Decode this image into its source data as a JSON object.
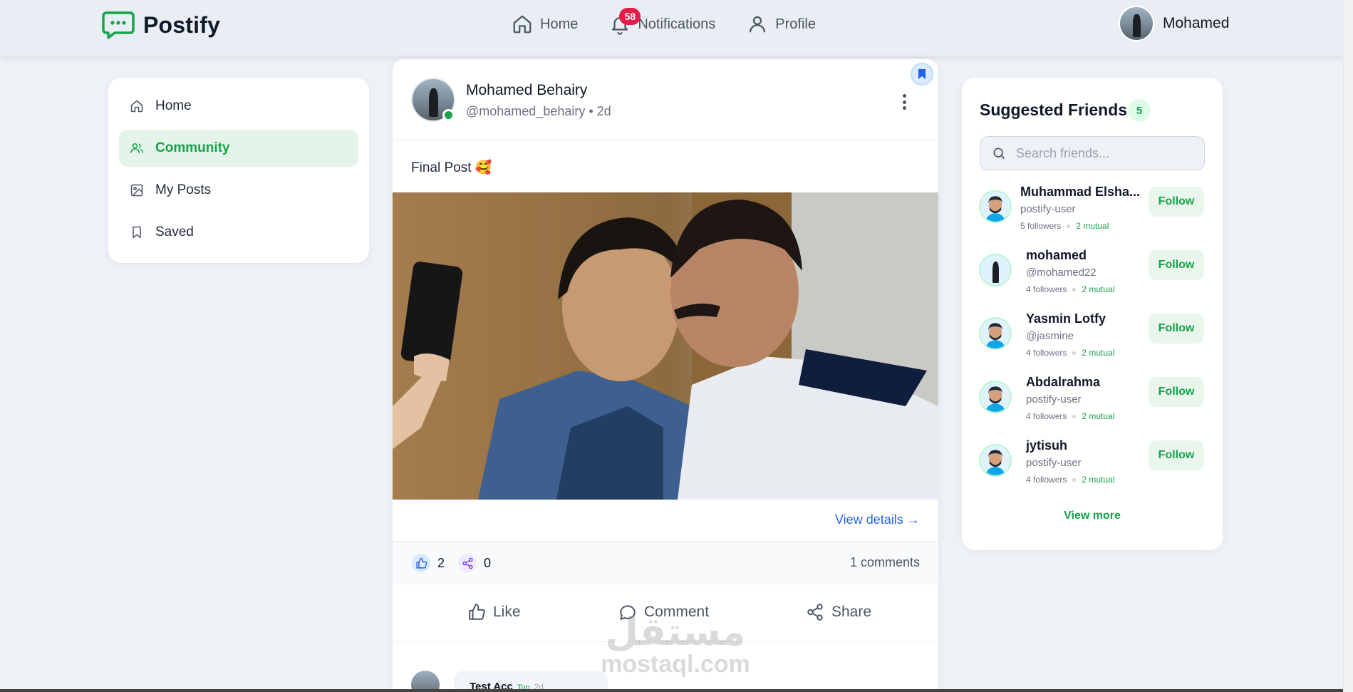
{
  "app": {
    "name": "Postify",
    "brand_color": "#16a34a"
  },
  "topnav": {
    "items": [
      {
        "label": "Home",
        "icon": "home-icon"
      },
      {
        "label": "Notifications",
        "icon": "bell-icon",
        "badge": "58"
      },
      {
        "label": "Profile",
        "icon": "user-icon"
      }
    ],
    "user_name": "Mohamed"
  },
  "sidebar": {
    "items": [
      {
        "label": "Home",
        "icon": "home-icon",
        "active": false
      },
      {
        "label": "Community",
        "icon": "users-icon",
        "active": true
      },
      {
        "label": "My Posts",
        "icon": "image-icon",
        "active": false
      },
      {
        "label": "Saved",
        "icon": "bookmark-icon",
        "active": false
      }
    ]
  },
  "post": {
    "author": "Mohamed Behairy",
    "meta": "@mohamed_behairy • 2d",
    "text": "Final Post 🥰",
    "view_details": "View details →",
    "likes": "2",
    "shares": "0",
    "comments_count": "1 comments",
    "actions": {
      "like": "Like",
      "comment": "Comment",
      "share": "Share"
    },
    "comment_preview": {
      "author": "Test Acc",
      "badge": "Top",
      "time": "2d"
    }
  },
  "friends": {
    "title": "Suggested Friends",
    "count": "5",
    "search_placeholder": "Search friends...",
    "items": [
      {
        "name": "Muhammad Elsha...",
        "handle": "postify-user",
        "followers": "5 followers",
        "mutual": "2 mutual",
        "button": "Follow"
      },
      {
        "name": "mohamed",
        "handle": "@mohamed22",
        "followers": "4 followers",
        "mutual": "2 mutual",
        "button": "Follow"
      },
      {
        "name": "Yasmin Lotfy",
        "handle": "@jasmine",
        "followers": "4 followers",
        "mutual": "2 mutual",
        "button": "Follow"
      },
      {
        "name": "Abdalrahma",
        "handle": "postify-user",
        "followers": "4 followers",
        "mutual": "2 mutual",
        "button": "Follow"
      },
      {
        "name": "jytisuh",
        "handle": "postify-user",
        "followers": "4 followers",
        "mutual": "2 mutual",
        "button": "Follow"
      }
    ],
    "view_more": "View more"
  },
  "watermark": {
    "arabic": "مستقل",
    "latin": "mostaql.com"
  }
}
